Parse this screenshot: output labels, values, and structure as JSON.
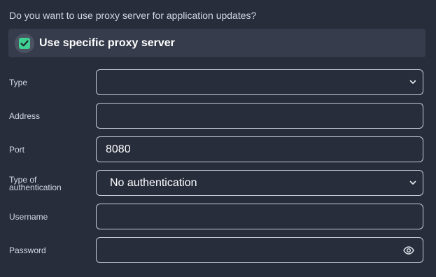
{
  "question": "Do you want to use proxy server for application updates?",
  "proxy_toggle": {
    "label": "Use specific proxy server",
    "checked": true,
    "accent_color": "#3fcf91"
  },
  "fields": {
    "type": {
      "label": "Type",
      "value": "",
      "icon": "chevron-down-icon"
    },
    "address": {
      "label": "Address",
      "value": ""
    },
    "port": {
      "label": "Port",
      "value": "8080"
    },
    "auth_type": {
      "label_line1": "Type of",
      "label_line2": "authentication",
      "value": "No authentication",
      "icon": "chevron-down-icon"
    },
    "username": {
      "label": "Username",
      "value": ""
    },
    "password": {
      "label": "Password",
      "value": "",
      "icon": "eye-icon"
    }
  }
}
